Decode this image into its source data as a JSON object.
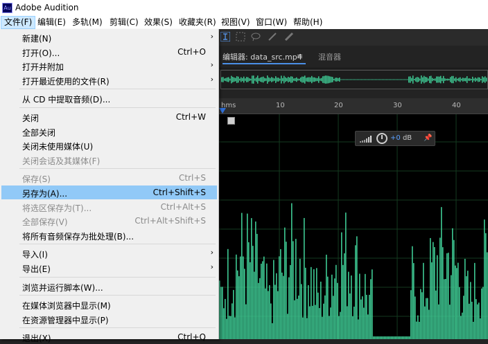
{
  "window": {
    "title": "Adobe Audition",
    "app_icon_text": "Au"
  },
  "menubar": [
    {
      "label": "文件(F)",
      "active": true
    },
    {
      "label": "编辑(E)"
    },
    {
      "label": "多轨(M)"
    },
    {
      "label": "剪辑(C)"
    },
    {
      "label": "效果(S)"
    },
    {
      "label": "收藏夹(R)"
    },
    {
      "label": "视图(V)"
    },
    {
      "label": "窗口(W)"
    },
    {
      "label": "帮助(H)"
    }
  ],
  "file_menu": {
    "items": [
      {
        "label": "新建(N)",
        "submenu": true
      },
      {
        "label": "打开(O)...",
        "shortcut": "Ctrl+O"
      },
      {
        "label": "打开并附加",
        "submenu": true
      },
      {
        "label": "打开最近使用的文件(R)",
        "submenu": true
      },
      {
        "separator": true
      },
      {
        "label": "从 CD 中提取音频(D)..."
      },
      {
        "separator": true
      },
      {
        "label": "关闭",
        "shortcut": "Ctrl+W"
      },
      {
        "label": "全部关闭"
      },
      {
        "label": "关闭未使用媒体(U)"
      },
      {
        "label": "关闭会话及其媒体(F)",
        "disabled": true
      },
      {
        "separator": true
      },
      {
        "label": "保存(S)",
        "shortcut": "Ctrl+S",
        "disabled": true
      },
      {
        "label": "另存为(A)...",
        "shortcut": "Ctrl+Shift+S",
        "highlighted": true
      },
      {
        "label": "将选区保存为(T)...",
        "shortcut": "Ctrl+Alt+S",
        "disabled": true
      },
      {
        "label": "全部保存(V)",
        "shortcut": "Ctrl+Alt+Shift+S",
        "disabled": true
      },
      {
        "label": "将所有音频保存为批处理(B)..."
      },
      {
        "separator": true
      },
      {
        "label": "导入(I)",
        "submenu": true
      },
      {
        "label": "导出(E)",
        "submenu": true
      },
      {
        "separator": true
      },
      {
        "label": "浏览并运行脚本(W)..."
      },
      {
        "separator": true
      },
      {
        "label": "在媒体浏览器中显示(M)"
      },
      {
        "label": "在资源管理器中显示(P)"
      },
      {
        "separator": true
      },
      {
        "label": "退出(X)",
        "shortcut": "Ctrl+Q"
      }
    ]
  },
  "editor": {
    "tab_label": "编辑器: data_src.mp4",
    "tab_menu_icon": "hamburger-icon",
    "mixer_tab_label": "混音器",
    "ruler_labels": [
      "hms",
      "10",
      "20",
      "30",
      "40"
    ],
    "hud": {
      "level": "+0",
      "unit": "dB"
    },
    "waveform_color": "#3ec993",
    "accent_color": "#2f6fd6"
  }
}
